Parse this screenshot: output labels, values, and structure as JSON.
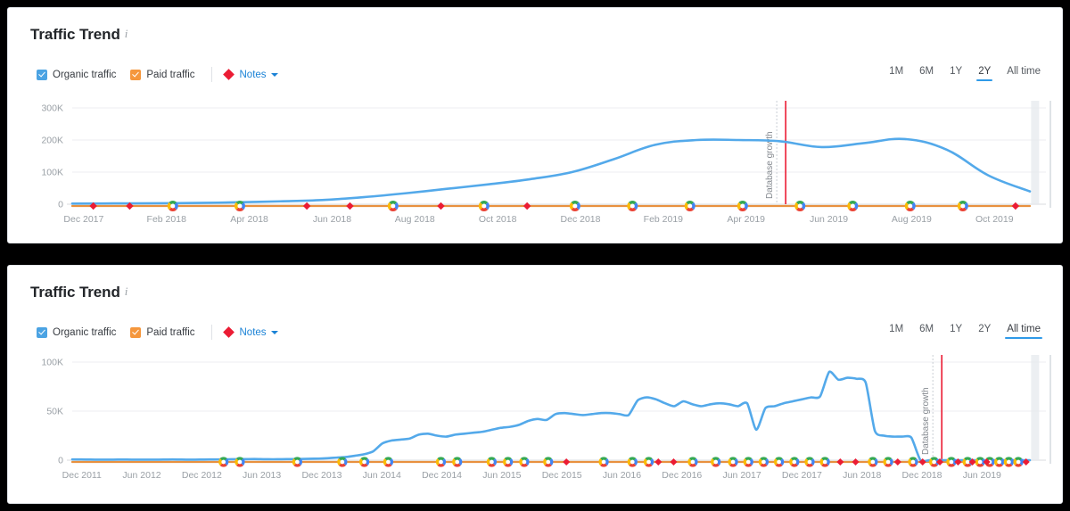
{
  "page": {
    "background": "#000000",
    "card_background": "#ffffff"
  },
  "colors": {
    "organic": "#53a9ea",
    "paid": "#e8913f",
    "note_marker": "#eb1c34",
    "accent": "#2f9ae8",
    "link": "#1a82d6",
    "grid": "#eceef0",
    "axis_text": "#9aa0a6"
  },
  "charts": [
    {
      "title": "Traffic Trend",
      "info_icon": "info-icon",
      "legend": {
        "organic": {
          "label": "Organic traffic",
          "checked": true,
          "color": "#4ba3e3"
        },
        "paid": {
          "label": "Paid traffic",
          "checked": true,
          "color": "#f5973d"
        },
        "notes": {
          "label": "Notes",
          "marker": "diamond-icon",
          "caret": "chevron-down-icon"
        }
      },
      "ranges": {
        "options": [
          "1M",
          "6M",
          "1Y",
          "2Y",
          "All time"
        ],
        "selected": "2Y"
      },
      "annotation": {
        "label": "Database growth",
        "at": "May 2019"
      },
      "chart_data": {
        "type": "line",
        "title": "Traffic Trend",
        "xlabel": "",
        "ylabel": "",
        "grid": true,
        "legend_position": "top-left",
        "ylim": [
          0,
          300000
        ],
        "yticks": [
          0,
          100000,
          200000,
          300000
        ],
        "ytick_labels": [
          "0",
          "100K",
          "200K",
          "300K"
        ],
        "xticks": [
          "Dec 2017",
          "Feb 2018",
          "Apr 2018",
          "Jun 2018",
          "Aug 2018",
          "Oct 2018",
          "Dec 2018",
          "Feb 2019",
          "Apr 2019",
          "Jun 2019",
          "Aug 2019",
          "Oct 2019"
        ],
        "x": [
          "Dec 2017",
          "Jan 2018",
          "Feb 2018",
          "Mar 2018",
          "Apr 2018",
          "May 2018",
          "Jun 2018",
          "Jul 2018",
          "Aug 2018",
          "Sep 2018",
          "Oct 2018",
          "Nov 2018",
          "Dec 2018",
          "Jan 2019",
          "Feb 2019",
          "Mar 2019",
          "Apr 2019",
          "May 2019",
          "Jun 2019",
          "Jul 2019",
          "Aug 2019",
          "Sep 2019",
          "Oct 2019",
          "Nov 2019"
        ],
        "series": [
          {
            "name": "Organic traffic",
            "color": "#53a9ea",
            "values": [
              2000,
              2500,
              3000,
              4000,
              6000,
              9000,
              13000,
              22000,
              34000,
              48000,
              62000,
              78000,
              100000,
              140000,
              185000,
              200000,
              200000,
              196000,
              178000,
              190000,
              203000,
              170000,
              90000,
              40000
            ]
          },
          {
            "name": "Paid traffic",
            "color": "#e8913f",
            "values": [
              0,
              0,
              0,
              0,
              0,
              0,
              0,
              0,
              0,
              0,
              0,
              0,
              0,
              0,
              0,
              0,
              0,
              0,
              0,
              0,
              0,
              0,
              0,
              0
            ]
          }
        ],
        "annotations": [
          {
            "type": "vline",
            "label": "Database growth",
            "x": "May 2019",
            "color": "#eb1c34"
          }
        ],
        "markers": {
          "google_update_icon": "google-update-marker",
          "note_icon": "note-marker"
        }
      }
    },
    {
      "title": "Traffic Trend",
      "info_icon": "info-icon",
      "legend": {
        "organic": {
          "label": "Organic traffic",
          "checked": true,
          "color": "#4ba3e3"
        },
        "paid": {
          "label": "Paid traffic",
          "checked": true,
          "color": "#f5973d"
        },
        "notes": {
          "label": "Notes",
          "marker": "diamond-icon",
          "caret": "chevron-down-icon"
        }
      },
      "ranges": {
        "options": [
          "1M",
          "6M",
          "1Y",
          "2Y",
          "All time"
        ],
        "selected": "All time"
      },
      "annotation": {
        "label": "Database growth",
        "at": "Mar 2019"
      },
      "chart_data": {
        "type": "line",
        "title": "Traffic Trend",
        "xlabel": "",
        "ylabel": "",
        "grid": true,
        "legend_position": "top-left",
        "ylim": [
          0,
          100000
        ],
        "yticks": [
          0,
          50000,
          100000
        ],
        "ytick_labels": [
          "0",
          "50K",
          "100K"
        ],
        "xticks": [
          "Dec 2011",
          "Jun 2012",
          "Dec 2012",
          "Jun 2013",
          "Dec 2013",
          "Jun 2014",
          "Dec 2014",
          "Jun 2015",
          "Dec 2015",
          "Jun 2016",
          "Dec 2016",
          "Jun 2017",
          "Dec 2017",
          "Jun 2018",
          "Dec 2018",
          "Jun 2019"
        ],
        "series": [
          {
            "name": "Organic traffic",
            "color": "#53a9ea",
            "values": [
              800,
              700,
              600,
              500,
              500,
              600,
              600,
              500,
              500,
              500,
              600,
              700,
              600,
              500,
              600,
              700,
              800,
              900,
              1000,
              1100,
              1200,
              1000,
              900,
              1000,
              1100,
              1200,
              1400,
              1600,
              2000,
              2600,
              3200,
              4500,
              6000,
              9000,
              17000,
              20000,
              21000,
              22000,
              26000,
              27000,
              25000,
              24000,
              26000,
              27000,
              28000,
              29000,
              31000,
              33000,
              34000,
              36000,
              40000,
              42000,
              41000,
              47000,
              48000,
              47000,
              46000,
              47000,
              48000,
              48000,
              47000,
              46000,
              61000,
              64000,
              62000,
              58000,
              55000,
              60000,
              57000,
              55000,
              57000,
              58000,
              57000,
              55000,
              58000,
              31000,
              53000,
              55000,
              58000,
              60000,
              62000,
              64000,
              65000,
              90000,
              82000,
              84000,
              83000,
              79000,
              30000,
              25000,
              24000,
              24000,
              23000,
              0,
              0,
              0,
              0,
              0,
              0,
              0,
              0,
              0,
              0,
              0,
              0,
              0
            ]
          },
          {
            "name": "Paid traffic",
            "color": "#e8913f",
            "values": [
              0,
              0,
              0,
              0,
              0,
              0,
              0,
              0,
              0,
              0,
              0,
              0,
              0,
              0,
              0,
              0,
              0,
              0,
              0,
              0,
              0,
              0,
              0,
              0,
              0,
              0,
              0,
              0,
              0,
              0,
              0,
              0,
              0,
              0,
              0,
              0,
              0,
              0,
              0,
              0,
              0,
              0,
              0,
              0,
              0,
              0,
              0,
              0,
              0,
              0,
              0,
              0,
              0,
              0,
              0,
              0,
              0,
              0,
              0,
              0,
              0,
              0,
              0,
              0,
              0,
              0,
              0,
              0,
              0,
              0,
              0,
              0,
              0,
              0,
              0,
              0,
              0,
              0,
              0,
              0,
              0,
              0,
              0,
              0,
              0,
              0,
              0,
              0,
              0,
              0,
              0,
              0,
              0,
              0,
              0,
              0,
              0,
              0,
              0,
              0,
              0,
              0,
              0,
              0,
              0
            ]
          }
        ],
        "annotations": [
          {
            "type": "vline",
            "label": "Database growth",
            "x": "Mar 2019",
            "color": "#eb1c34"
          }
        ],
        "markers": {
          "google_update_icon": "google-update-marker",
          "note_icon": "note-marker"
        }
      }
    }
  ]
}
